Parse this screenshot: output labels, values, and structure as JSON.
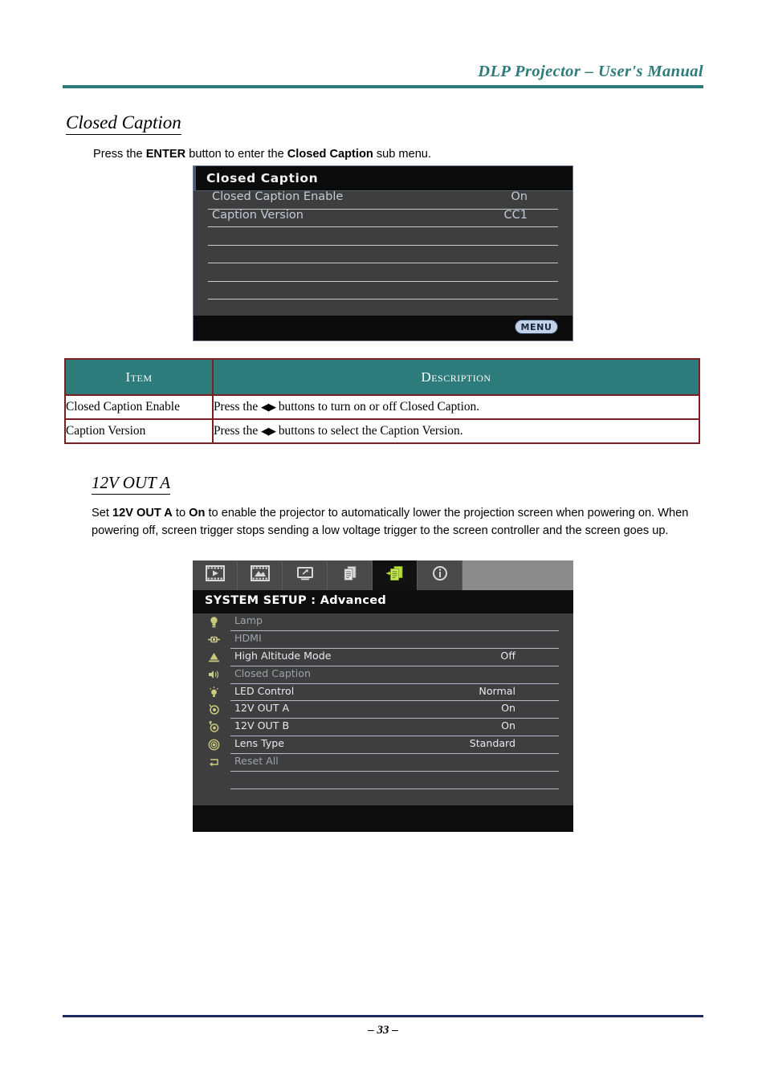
{
  "header": {
    "title": "DLP Projector – User's Manual",
    "rule_color": "#2d7b7b"
  },
  "sections": {
    "closed_caption": {
      "heading": "Closed Caption",
      "intro_prefix": "Press the ",
      "intro_bold1": "ENTER",
      "intro_mid": " button to enter the ",
      "intro_bold2": "Closed Caption",
      "intro_suffix": " sub menu."
    },
    "twelve_v_out_a": {
      "heading": "12V OUT A",
      "para_p1": "Set ",
      "para_b1": "12V OUT A",
      "para_p2": " to ",
      "para_b2": "On",
      "para_p3": " to enable the projector to automatically lower the projection screen when powering on. When powering off, screen trigger stops sending a low voltage trigger to the screen controller and the screen goes up."
    }
  },
  "osd_closed_caption": {
    "title": "Closed Caption",
    "rows": [
      {
        "label": "Closed Caption Enable",
        "value": "On"
      },
      {
        "label": "Caption Version",
        "value": "CC1"
      },
      {
        "label": "",
        "value": ""
      },
      {
        "label": "",
        "value": ""
      },
      {
        "label": "",
        "value": ""
      },
      {
        "label": "",
        "value": ""
      }
    ],
    "menu_button": "MENU"
  },
  "spec_table": {
    "columns": [
      "Item",
      "Description"
    ],
    "rows": [
      {
        "item": "Closed Caption Enable",
        "desc_prefix": "Press the ",
        "desc_arrows": "◀▶",
        "desc_suffix": " buttons to turn on or off Closed Caption."
      },
      {
        "item": "Caption Version",
        "desc_prefix": "Press the ",
        "desc_arrows": "◀▶",
        "desc_suffix": " buttons to select the Caption Version."
      }
    ]
  },
  "osd_system_setup": {
    "title": "SYSTEM SETUP : Advanced",
    "tabs": [
      {
        "name": "image-tab",
        "active": false
      },
      {
        "name": "picture-tab",
        "active": false
      },
      {
        "name": "display-tab",
        "active": false
      },
      {
        "name": "system-setup-basic-tab",
        "active": false
      },
      {
        "name": "system-setup-advanced-tab",
        "active": true
      },
      {
        "name": "information-tab",
        "active": false
      }
    ],
    "rows": [
      {
        "icon": "lamp-icon",
        "label": "Lamp",
        "value": "",
        "bright": false
      },
      {
        "icon": "hdmi-icon",
        "label": "HDMI",
        "value": "",
        "bright": false
      },
      {
        "icon": "altitude-icon",
        "label": "High Altitude Mode",
        "value": "Off",
        "bright": true
      },
      {
        "icon": "closed-caption-icon",
        "label": "Closed Caption",
        "value": "",
        "bright": false
      },
      {
        "icon": "led-icon",
        "label": "LED Control",
        "value": "Normal",
        "bright": true
      },
      {
        "icon": "trigger-a-icon",
        "label": "12V OUT A",
        "value": "On",
        "bright": true
      },
      {
        "icon": "trigger-b-icon",
        "label": "12V OUT B",
        "value": "On",
        "bright": true
      },
      {
        "icon": "lens-icon",
        "label": "Lens Type",
        "value": "Standard",
        "bright": true
      },
      {
        "icon": "reset-icon",
        "label": "Reset All",
        "value": "",
        "bright": false
      },
      {
        "icon": "",
        "label": "",
        "value": "",
        "bright": false
      }
    ]
  },
  "footer": {
    "page_number": "– 33 –",
    "rule_color": "#1f2a5c"
  }
}
